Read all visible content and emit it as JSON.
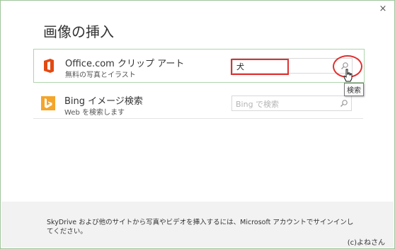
{
  "dialog": {
    "title": "画像の挿入",
    "close_label": "×"
  },
  "sources": [
    {
      "title": "Office.com クリップ アート",
      "subtitle": "無料の写真とイラスト",
      "search_value": "犬",
      "search_placeholder": "",
      "icon": "office-icon",
      "icon_color": "#e24a13"
    },
    {
      "title": "Bing イメージ検索",
      "subtitle": "Web を検索します",
      "search_value": "",
      "search_placeholder": "Bing で検索",
      "icon": "bing-icon",
      "icon_color": "#f4a52b"
    }
  ],
  "tooltip": "検索",
  "footer": {
    "text": "SkyDrive および他のサイトから写真やビデオを挿入するには、Microsoft アカウントでサインインしてください。",
    "credit": "(c)よねさん"
  },
  "colors": {
    "highlight": "#e03030",
    "selected_border": "#aed5ab"
  }
}
